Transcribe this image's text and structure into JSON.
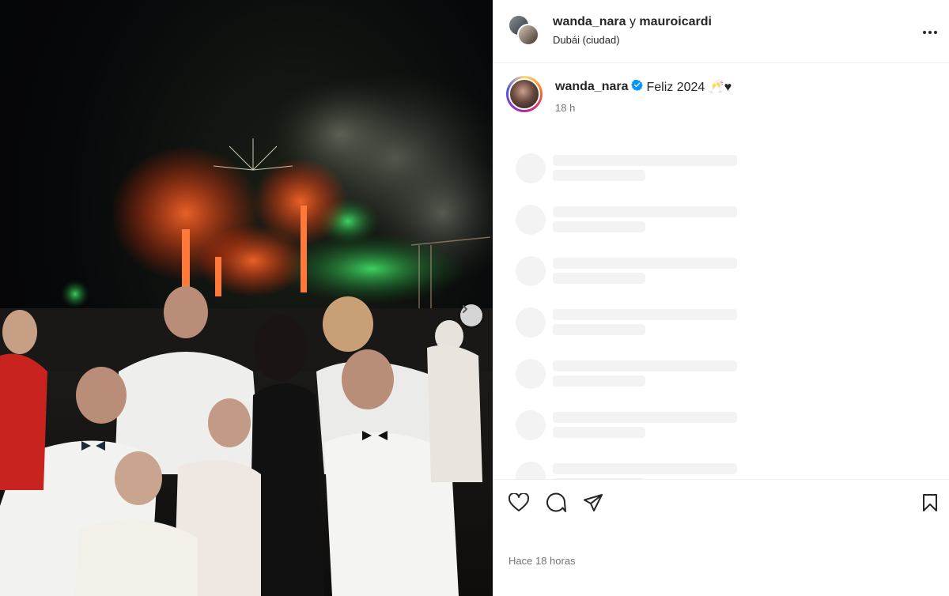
{
  "post": {
    "header": {
      "user1": "wanda_nara",
      "conjunction": "y",
      "user2": "mauroicardi",
      "location": "Dubái (ciudad)"
    },
    "caption": {
      "username": "wanda_nara",
      "text": "Feliz 2024 🥂♥",
      "time": "18 h"
    },
    "comments_loading_rows": 7,
    "timestamp": "Hace 18 horas",
    "image": {
      "description_icon": "photo-carousel",
      "has_next": true
    }
  },
  "icons": {
    "more": "more-icon",
    "like": "heart-icon",
    "comment": "comment-icon",
    "share": "share-icon",
    "save": "bookmark-icon",
    "next": "chevron-right-icon",
    "verified": "verified-badge-icon"
  },
  "colors": {
    "verified_blue": "#0095f6",
    "text_primary": "#262626",
    "text_secondary": "#737373",
    "skeleton": "#f3f3f3",
    "divider": "#efefef"
  }
}
